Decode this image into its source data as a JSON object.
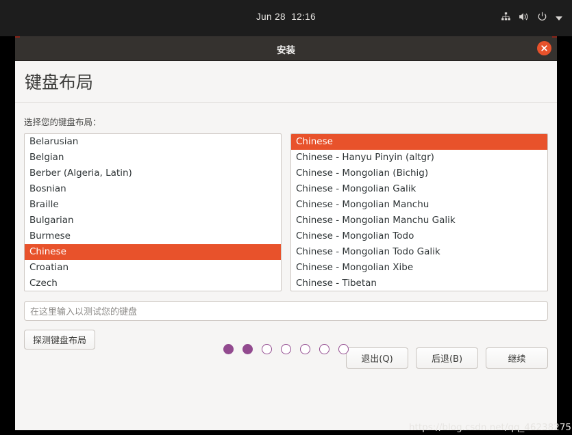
{
  "topbar": {
    "clock": "Jun 28  12:16",
    "icons": [
      "network-wired-icon",
      "volume-icon",
      "power-icon",
      "chevron-down-icon"
    ]
  },
  "window": {
    "title": "安装",
    "close_label": "×"
  },
  "page": {
    "title": "键盘布局",
    "field_label": "选择您的键盘布局："
  },
  "layout_list": {
    "selected": "Chinese",
    "items": [
      "Belarusian",
      "Belgian",
      "Berber (Algeria, Latin)",
      "Bosnian",
      "Braille",
      "Bulgarian",
      "Burmese",
      "Chinese",
      "Croatian",
      "Czech"
    ]
  },
  "variant_list": {
    "selected": "Chinese",
    "items": [
      "Chinese",
      "Chinese - Hanyu Pinyin (altgr)",
      "Chinese - Mongolian (Bichig)",
      "Chinese - Mongolian Galik",
      "Chinese - Mongolian Manchu",
      "Chinese - Mongolian Manchu Galik",
      "Chinese - Mongolian Todo",
      "Chinese - Mongolian Todo Galik",
      "Chinese - Mongolian Xibe",
      "Chinese - Tibetan"
    ]
  },
  "test_input": {
    "value": "",
    "placeholder": "在这里输入以测试您的键盘"
  },
  "detect_button": "探测键盘布局",
  "footer": {
    "quit": "退出(Q)",
    "back": "后退(B)",
    "continue": "继续"
  },
  "progress": {
    "total": 7,
    "completed": 2
  },
  "watermark": "https://blog.csdn.net/qq_46238275",
  "colors": {
    "accent_selection": "#e8522b",
    "topbar_bg": "#1d1d1d",
    "titlebar_bg": "#35322f",
    "page_bg": "#f6f5f4",
    "dot_purple": "#924a8f"
  }
}
